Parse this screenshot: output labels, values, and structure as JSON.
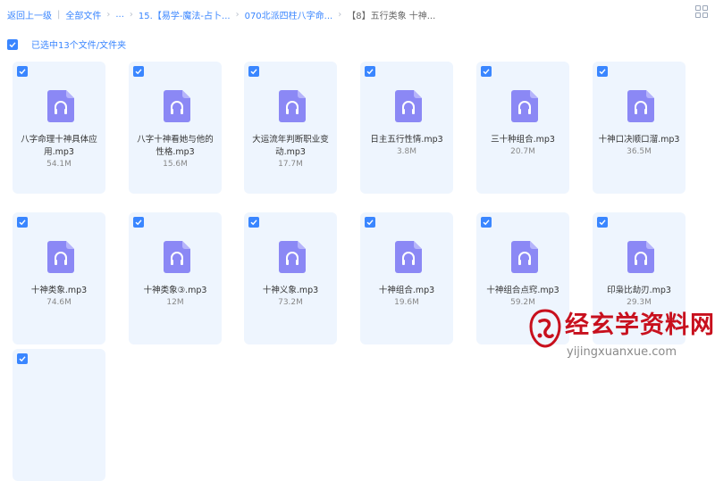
{
  "breadcrumb": {
    "back": "返回上一级",
    "all_files": "全部文件",
    "ellipsis": "...",
    "crumb1": "15.【易学-魔法-占卜...",
    "crumb2": "070北派四柱八字命...",
    "current": "【8】五行类象 十神..."
  },
  "selection": {
    "label": "已选中13个文件/文件夹"
  },
  "files": [
    {
      "name": "八字命理十神具体应用.mp3",
      "size": "54.1M"
    },
    {
      "name": "八字十神看她与他的性格.mp3",
      "size": "15.6M"
    },
    {
      "name": "大运流年判断职业变动.mp3",
      "size": "17.7M"
    },
    {
      "name": "日主五行性情.mp3",
      "size": "3.8M"
    },
    {
      "name": "三十种组合.mp3",
      "size": "20.7M"
    },
    {
      "name": "十神口决顺口溜.mp3",
      "size": "36.5M"
    },
    {
      "name": "十神类象.mp3",
      "size": "74.6M"
    },
    {
      "name": "十神类象③.mp3",
      "size": "12M"
    },
    {
      "name": "十神义象.mp3",
      "size": "73.2M"
    },
    {
      "name": "十神组合.mp3",
      "size": "19.6M"
    },
    {
      "name": "十神组合点窍.mp3",
      "size": "59.2M"
    },
    {
      "name": "印枭比劫刃.mp3",
      "size": "29.3M"
    },
    {
      "name": "",
      "size": ""
    }
  ],
  "watermark": {
    "title": "经玄学资料网",
    "url": "yijingxuanxue.com"
  },
  "colors": {
    "accent": "#3a86ff",
    "card_bg": "#eef5fe",
    "icon": "#8b88f5",
    "brand_red": "#c8101d"
  }
}
